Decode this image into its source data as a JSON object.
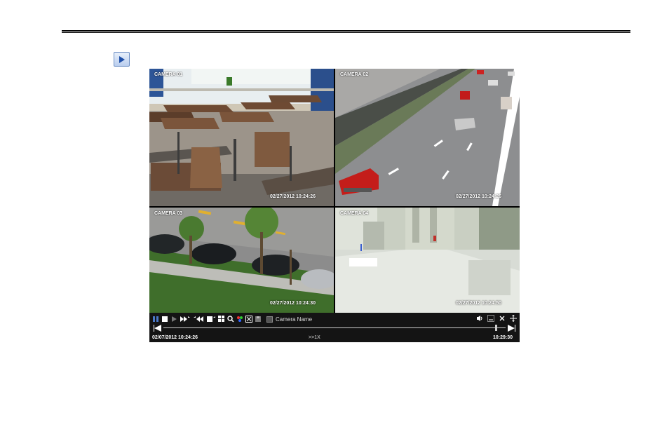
{
  "cameras": [
    {
      "label": "CAMERA 01",
      "timestamp": "02/27/2012 10:24:26"
    },
    {
      "label": "CAMERA 02",
      "timestamp": "02/27/2012 10:24:26"
    },
    {
      "label": "CAMERA 03",
      "timestamp": "02/27/2012 10:24:30"
    },
    {
      "label": "CAMERA 04",
      "timestamp": "02/27/2012 10:24:50"
    }
  ],
  "toolbar": {
    "camera_name_label": "Camera Name",
    "icons": [
      "pause-icon",
      "stop-icon",
      "play-icon",
      "fast-forward-icon",
      "rewind-icon",
      "single-screen-icon",
      "quad-screen-icon",
      "zoom-icon",
      "color-icon",
      "clip-icon",
      "save-icon",
      "volume-icon",
      "minimize-icon",
      "close-icon",
      "fullscreen-icon"
    ]
  },
  "playback": {
    "start_time": "02/07/2012 10:24:26",
    "speed": ">>1X",
    "end_time": "10:29:30",
    "progress_fraction": 0.97
  },
  "colors": {
    "accent": "#4a78c8",
    "toolbar_bg": "#141414"
  }
}
